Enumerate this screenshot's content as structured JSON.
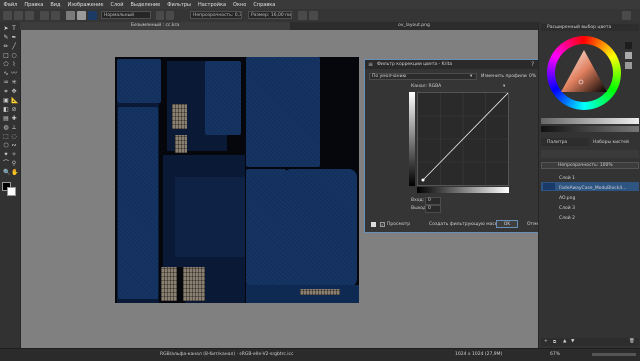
{
  "menu": [
    "Файл",
    "Правка",
    "Вид",
    "Изображение",
    "Слой",
    "Выделение",
    "Фильтры",
    "Настройка",
    "Окно",
    "Справка"
  ],
  "toolbar": {
    "blend_mode": "Нормальный",
    "opacity_label": "Непрозрачность: 0,30",
    "size_label": "Размер: 16,00 пикс"
  },
  "tabs": {
    "active": "Безымянный : cc.kra",
    "inactive": "ov_layout.png"
  },
  "dialog": {
    "title": "Фильтр коррекции цвета - Krita",
    "preset": "По умолчанию",
    "edit_profiles": "Изменить профили",
    "percent": "0%",
    "channel_label": "Канал: RGBA",
    "input_label": "Вход:",
    "input_value": "0",
    "output_label": "Выход:",
    "output_value": "0",
    "preview_label": "Просмотр",
    "create_filter_mask": "Создать фильтрующую маску",
    "ok": "OK",
    "cancel": "Отмена"
  },
  "docker": {
    "advanced_color_selector": "Расширенный выбор цвета",
    "tab_palette": "Палитра",
    "tab_brush_presets": "Наборы кистей",
    "opacity_label": "Непрозрачность: 100%",
    "layers": [
      {
        "name": "Слой 1",
        "selected": false
      },
      {
        "name": "FadeAwayCase_ModuBlock4...",
        "selected": true
      },
      {
        "name": "AO.png",
        "selected": false
      },
      {
        "name": "Слой 3",
        "selected": false
      },
      {
        "name": "Слой 2",
        "selected": false
      }
    ]
  },
  "status": {
    "color_info": "RGB/альфа-канал (8-бит/канал) · sRGB-elle-V2-srgbtrc.icc",
    "dimensions": "1024 x 1024 (27,9M)",
    "zoom": "67%"
  },
  "colors": {
    "accent": "#6a8fb7",
    "selected_layer": "#2e5582",
    "texture_blue": "#12305e"
  }
}
